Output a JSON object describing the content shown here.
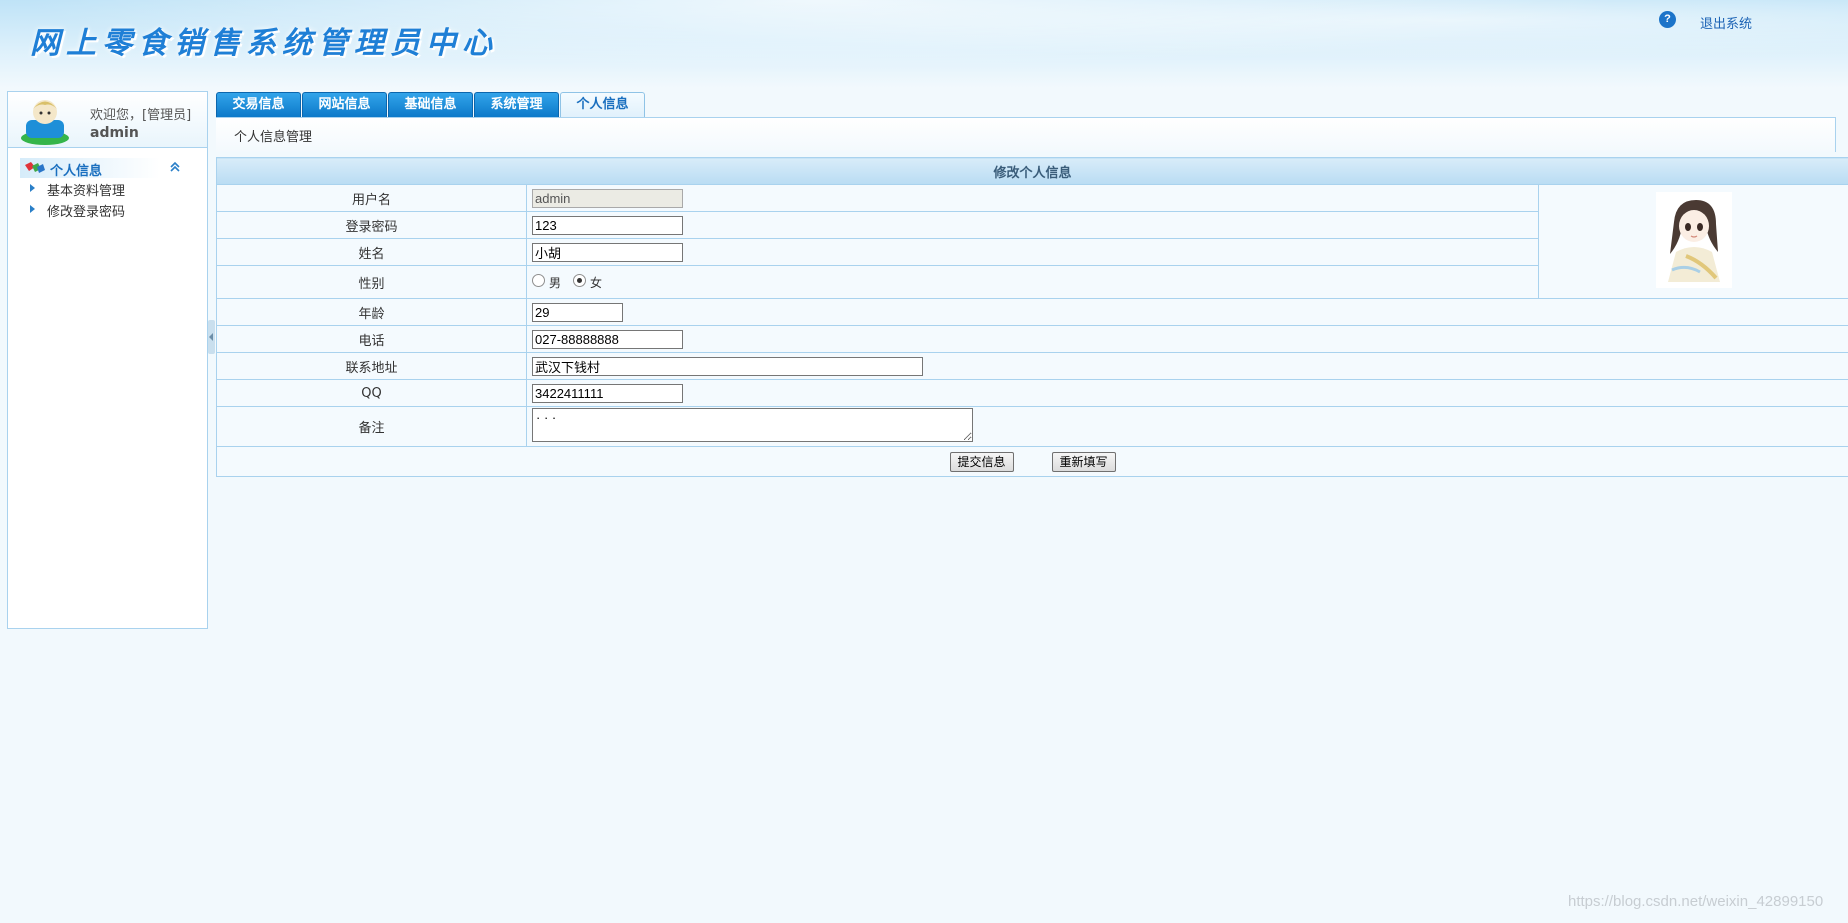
{
  "header": {
    "title": "网上零食销售系统管理员中心",
    "help_icon_glyph": "?",
    "logout_label": "退出系统"
  },
  "sidebar": {
    "welcome": "欢迎您，[管理员]",
    "username": "admin",
    "menu_title": "个人信息",
    "items": [
      {
        "label": "基本资料管理"
      },
      {
        "label": "修改登录密码"
      }
    ]
  },
  "tabs": [
    {
      "label": "交易信息"
    },
    {
      "label": "网站信息"
    },
    {
      "label": "基础信息"
    },
    {
      "label": "系统管理"
    },
    {
      "label": "个人信息",
      "active": true
    }
  ],
  "subnav": {
    "label": "个人信息管理"
  },
  "form": {
    "caption": "修改个人信息",
    "fields": {
      "username": {
        "label": "用户名",
        "value": "admin"
      },
      "password": {
        "label": "登录密码",
        "value": "123"
      },
      "name": {
        "label": "姓名",
        "value": "小胡"
      },
      "gender": {
        "label": "性别",
        "options": [
          "男",
          "女"
        ],
        "selected": "女"
      },
      "age": {
        "label": "年龄",
        "value": "29"
      },
      "phone": {
        "label": "电话",
        "value": "027-88888888"
      },
      "address": {
        "label": "联系地址",
        "value": "武汉下钱村"
      },
      "qq": {
        "label": "QQ",
        "value": "3422411111"
      },
      "remark": {
        "label": "备注",
        "value": "· · ·"
      }
    },
    "submit_label": "提交信息",
    "reset_label": "重新填写"
  },
  "watermark": "https://blog.csdn.net/weixin_42899150",
  "colors": {
    "accent": "#1f7fd6",
    "tab_blue": "#0c79c9",
    "border": "#a9d2ee",
    "background": "#f2f9fd"
  }
}
